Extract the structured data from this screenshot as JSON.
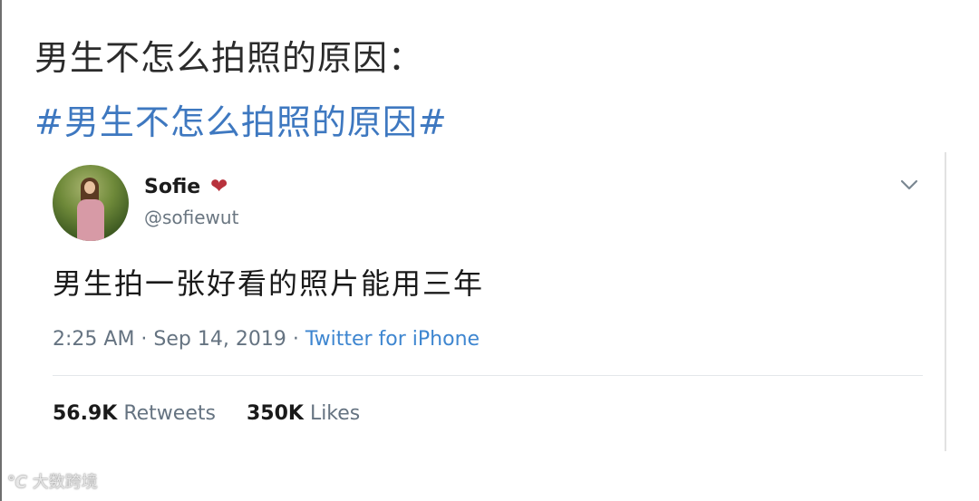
{
  "post": {
    "headline": "男生不怎么拍照的原因：",
    "hashtag": "#男生不怎么拍照的原因#"
  },
  "tweet": {
    "display_name": "Sofie",
    "name_emoji": "heart-icon",
    "handle": "@sofiewut",
    "text": "男生拍一张好看的照片能用三年",
    "time": "2:25 AM · Sep 14, 2019 · ",
    "source": "Twitter for iPhone",
    "retweets_count": "56.9K",
    "retweets_label": "Retweets",
    "likes_count": "350K",
    "likes_label": "Likes"
  },
  "watermark": {
    "logo": "℃",
    "text": "大数跨境"
  },
  "colors": {
    "hashtag": "#3e78c0",
    "link": "#3e86d0",
    "heart": "#b8323c"
  }
}
